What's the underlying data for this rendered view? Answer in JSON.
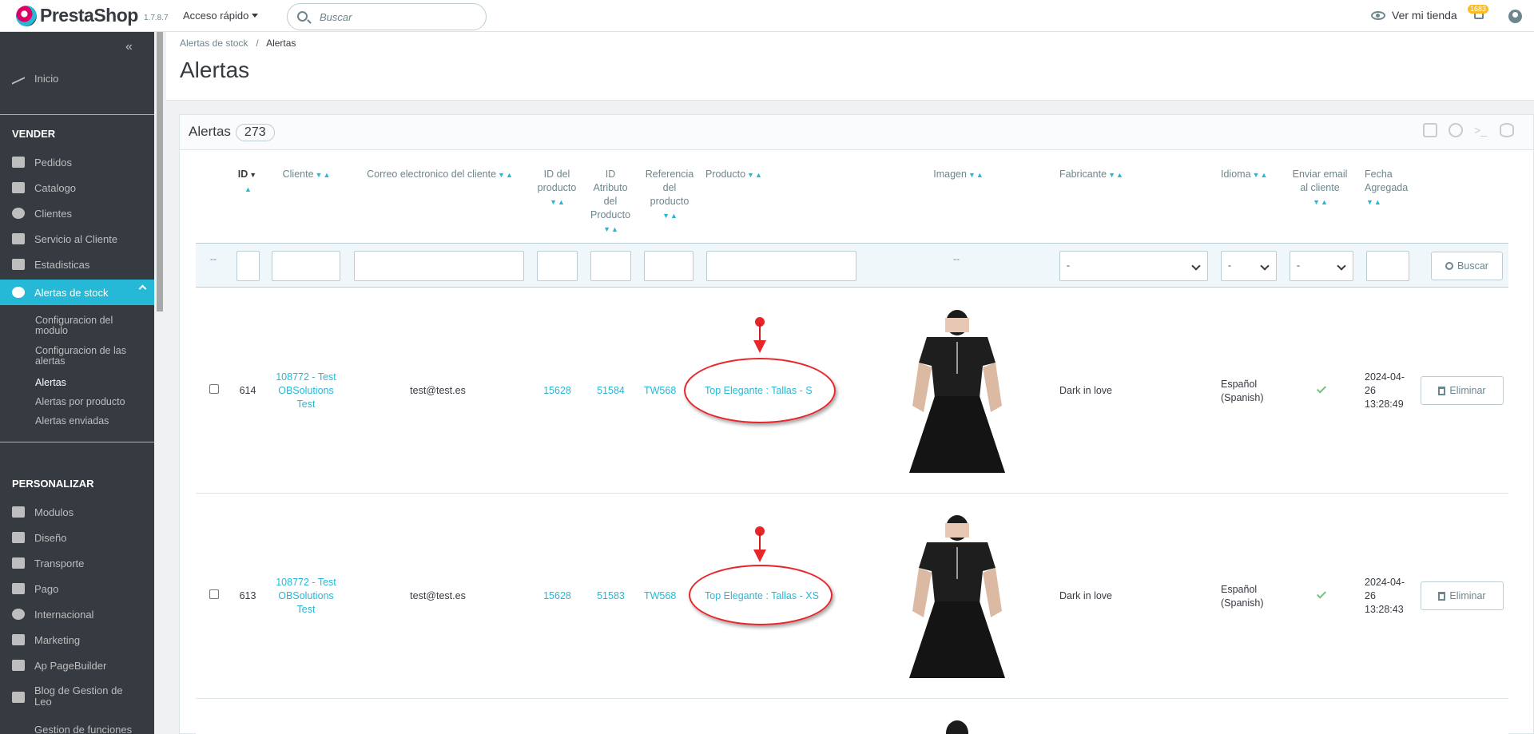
{
  "app": {
    "logo_text": "PrestaShop",
    "version": "1.7.8.7",
    "quick_access": "Acceso rápido",
    "search_placeholder": "Buscar",
    "view_shop": "Ver mi tienda",
    "notifications_count": "1683"
  },
  "sidebar": {
    "home": "Inicio",
    "section_sell": "VENDER",
    "sell_items": [
      "Pedidos",
      "Catalogo",
      "Clientes",
      "Servicio al Cliente",
      "Estadisticas"
    ],
    "active_item": "Alertas de stock",
    "subitems": [
      "Configuracion del modulo",
      "Configuracion de las alertas",
      "Alertas",
      "Alertas por producto",
      "Alertas enviadas"
    ],
    "section_customize": "PERSONALIZAR",
    "customize_items": [
      "Modulos",
      "Diseño",
      "Transporte",
      "Pago",
      "Internacional",
      "Marketing",
      "Ap PageBuilder",
      "Blog de Gestion de Leo",
      "Gestion de funciones"
    ]
  },
  "page": {
    "breadcrumb": [
      "Alertas de stock",
      "Alertas"
    ],
    "title": "Alertas"
  },
  "panel": {
    "title": "Alertas",
    "count": "273",
    "search_button": "Buscar",
    "delete_button": "Eliminar",
    "filter_dash": "--",
    "filter_select_default": "-"
  },
  "table": {
    "columns": {
      "id": "ID",
      "cliente": "Cliente",
      "email": "Correo electronico del cliente",
      "id_producto": "ID del producto",
      "id_atributo": "ID Atributo del Producto",
      "referencia": "Referencia del producto",
      "producto": "Producto",
      "imagen": "Imagen",
      "fabricante": "Fabricante",
      "idioma": "Idioma",
      "enviar": "Enviar email al cliente",
      "fecha": "Fecha Agregada"
    },
    "rows": [
      {
        "id": "614",
        "cliente": "108772 - Test OBSolutions Test",
        "email": "test@test.es",
        "id_producto": "15628",
        "id_atributo": "51584",
        "referencia": "TW568",
        "producto": "Top Elegante : Tallas - S",
        "fabricante": "Dark in love",
        "idioma": "Español (Spanish)",
        "fecha": "2024-04-26 13:28:49"
      },
      {
        "id": "613",
        "cliente": "108772 - Test OBSolutions Test",
        "email": "test@test.es",
        "id_producto": "15628",
        "id_atributo": "51583",
        "referencia": "TW568",
        "producto": "Top Elegante : Tallas - XS",
        "fabricante": "Dark in love",
        "idioma": "Español (Spanish)",
        "fecha": "2024-04-26 13:28:43"
      }
    ]
  },
  "colors": {
    "accent": "#25b9d7",
    "sidebar_bg": "#363a41",
    "annotation_red": "#e8262a",
    "check_green": "#72c279"
  }
}
